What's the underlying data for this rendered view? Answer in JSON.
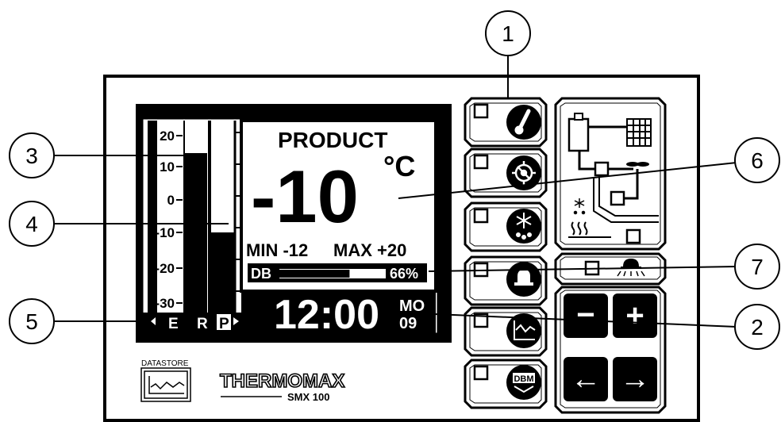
{
  "device": {
    "brand": "THERMOMAX",
    "model": "SMX 100",
    "datastore_label": "DATASTORE"
  },
  "display": {
    "scale_ticks": [
      "20",
      "10",
      "0",
      "-10",
      "-20",
      "-30"
    ],
    "bar_letters": [
      "E",
      "R",
      "P"
    ],
    "product_label": "PRODUCT",
    "temperature": "-10",
    "unit": "°C",
    "min_label": "MIN -12",
    "max_label": "MAX +20",
    "db_label": "DB",
    "db_percent_text": "66%",
    "db_fill": 0.66,
    "time": "12:00",
    "day": "MO",
    "date": "09"
  },
  "function_buttons": [
    {
      "icon": "thermometer-icon"
    },
    {
      "icon": "defrost-fan-icon"
    },
    {
      "icon": "snowflake-drip-icon"
    },
    {
      "icon": "bell-icon"
    },
    {
      "icon": "graph-icon"
    },
    {
      "icon": "dbm-icon",
      "label": "DBM"
    }
  ],
  "nav_buttons": {
    "minus": "−",
    "plus": "+",
    "left": "←",
    "right": "→"
  },
  "callouts": [
    "1",
    "2",
    "3",
    "4",
    "5",
    "6",
    "7"
  ]
}
